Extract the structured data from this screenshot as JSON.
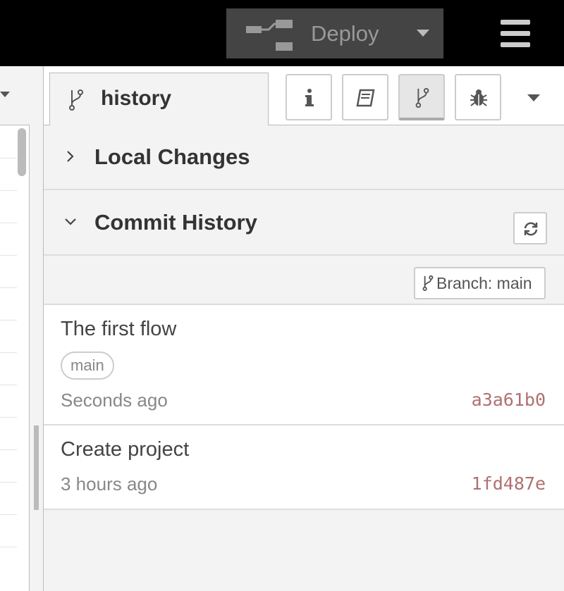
{
  "header": {
    "deploy_label": "Deploy",
    "deploy_icon": "deploy-flow-icon",
    "menu_icon": "hamburger-menu-icon"
  },
  "sidebar": {
    "active_tab": {
      "label": "history",
      "icon": "git-branch-icon"
    },
    "tab_buttons": [
      {
        "icon": "info-icon"
      },
      {
        "icon": "book-icon"
      },
      {
        "icon": "git-branch-icon",
        "selected": true
      },
      {
        "icon": "bug-icon"
      }
    ],
    "sections": {
      "local_changes": {
        "title": "Local Changes",
        "expanded": false
      },
      "commit_history": {
        "title": "Commit History",
        "expanded": true
      }
    },
    "branch_button": "Branch: main",
    "commits": [
      {
        "message": "The first flow",
        "tag": "main",
        "time": "Seconds ago",
        "sha": "a3a61b0"
      },
      {
        "message": "Create project",
        "time": "3 hours ago",
        "sha": "1fd487e"
      }
    ]
  },
  "colors": {
    "header_bg": "#000000",
    "deploy_bg": "#444444",
    "sha": "#b07070",
    "panel_bg": "#f3f3f3"
  }
}
